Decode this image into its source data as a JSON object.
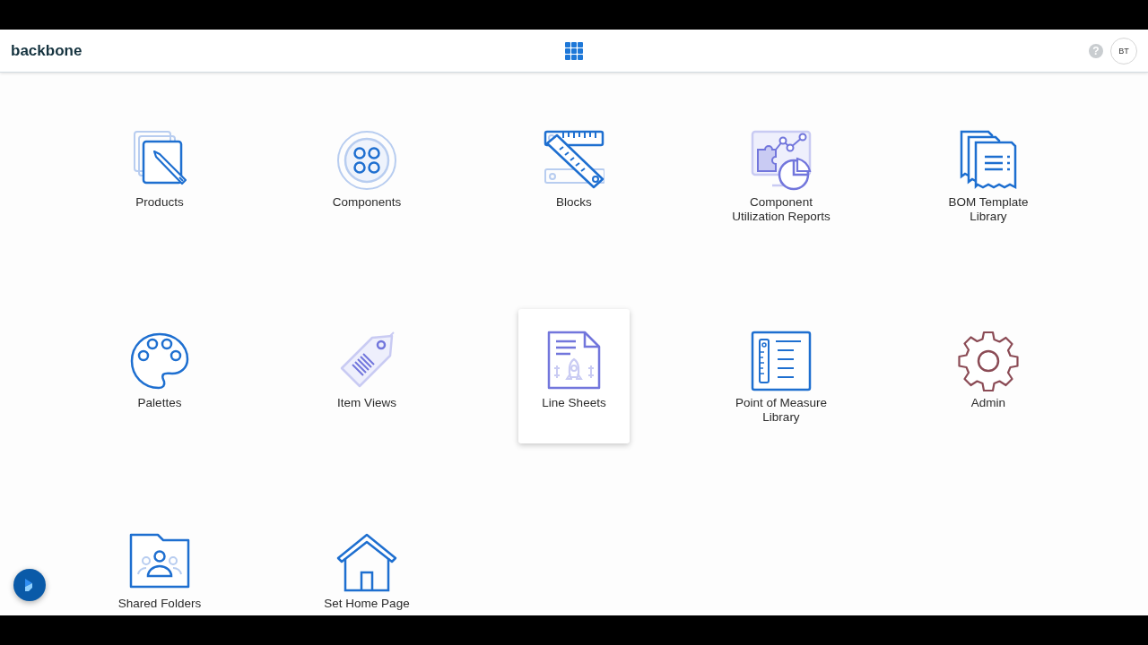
{
  "header": {
    "logo": "backbone",
    "help_icon": "?",
    "avatar": "BT"
  },
  "tiles": [
    {
      "label": "Products",
      "highlighted": false
    },
    {
      "label": "Components",
      "highlighted": false
    },
    {
      "label": "Blocks",
      "highlighted": false
    },
    {
      "label": "Component Utilization Reports",
      "highlighted": false
    },
    {
      "label": "BOM Template Library",
      "highlighted": false
    },
    {
      "label": "Palettes",
      "highlighted": false
    },
    {
      "label": "Item Views",
      "highlighted": false
    },
    {
      "label": "Line Sheets",
      "highlighted": true
    },
    {
      "label": "Point of Measure Library",
      "highlighted": false
    },
    {
      "label": "Admin",
      "highlighted": false
    },
    {
      "label": "Shared Folders",
      "highlighted": false
    },
    {
      "label": "Set Home Page",
      "highlighted": false
    }
  ]
}
